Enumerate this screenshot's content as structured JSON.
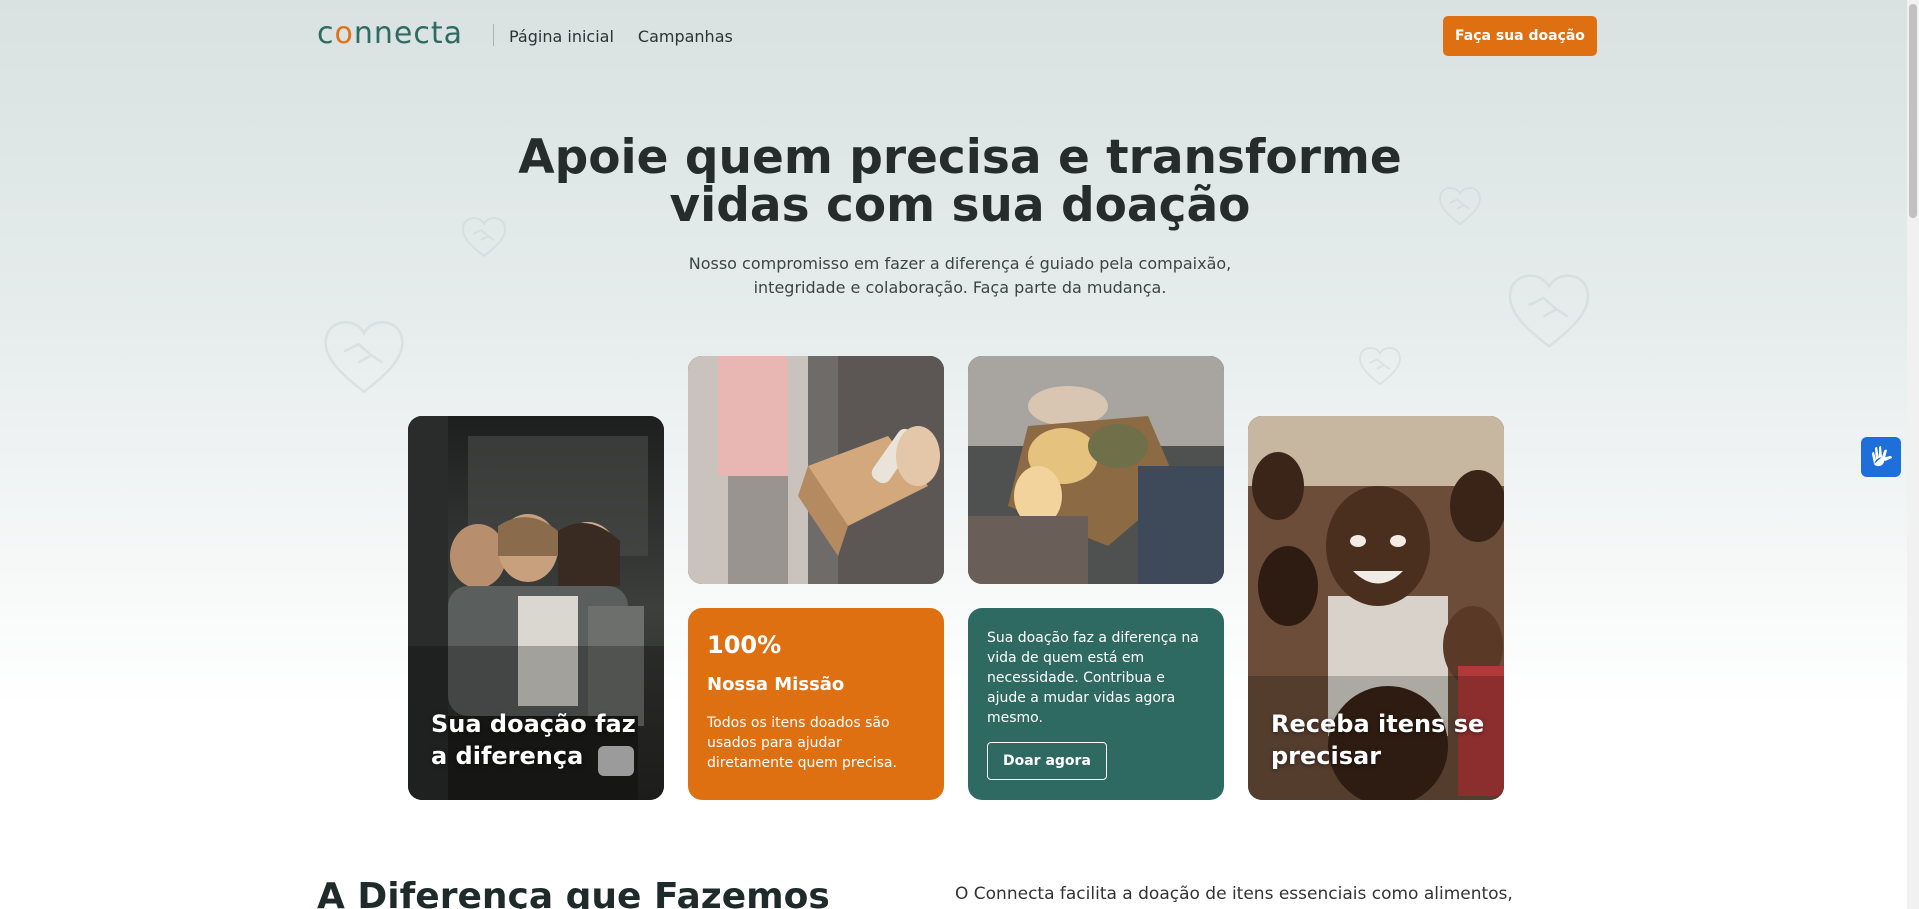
{
  "header": {
    "logo": "connecta",
    "nav": [
      "Página inicial",
      "Campanhas"
    ],
    "donate_label": "Faça sua doação"
  },
  "hero": {
    "title_line1": "Apoie quem precisa e transforme",
    "title_line2": "vidas com sua doação",
    "subtitle_line1": "Nosso compromisso em fazer a diferença é guiado pela compaixão,",
    "subtitle_line2": "integridade e colaboração. Faça parte da mudança."
  },
  "cards": {
    "children_caption": "Sua doação faz a diferença",
    "mission": {
      "stat": "100%",
      "title": "Nossa Missão",
      "text": "Todos os itens doados são usados para ajudar diretamente quem precisa."
    },
    "cta": {
      "text": "Sua doação faz a diferença na vida de quem está em necessidade. Contribua e ajude a mudar vidas agora mesmo.",
      "button": "Doar agora"
    },
    "receive_caption": "Receba itens se precisar"
  },
  "section": {
    "title": "A Diferença que Fazemos",
    "text": "O Connecta facilita a doação de itens essenciais como alimentos, roupas e"
  },
  "icons": {
    "accessibility": "sign-language-hands-icon",
    "decor": "heart-handshake-icon"
  },
  "colors": {
    "brand_teal": "#2e6a62",
    "brand_orange": "#df7012",
    "accessibility_blue": "#1e6fd9"
  }
}
